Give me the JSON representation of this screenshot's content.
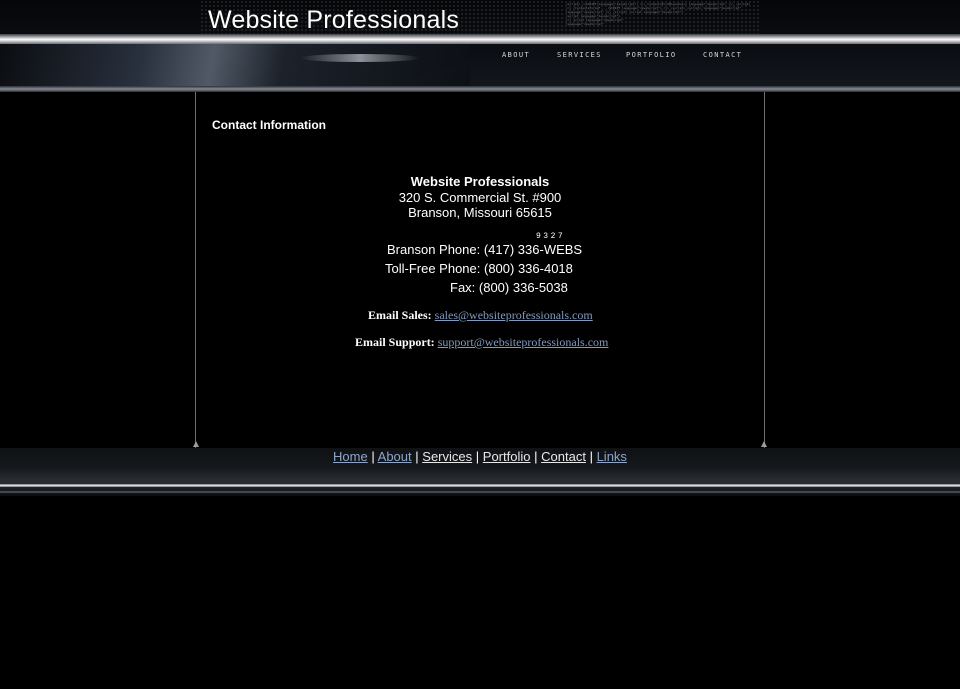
{
  "header": {
    "logo_text": "Website Professionals",
    "nav": [
      "ABOUT",
      "SERVICES",
      "PORTFOLIO",
      "CONTACT"
    ],
    "code_lines": [
      "<script> /<SCRIPT>language=\"JavaScript\"> <\\\\ ContentsFormMouseOver> language=\"JavaScript\" <\\\\ /script> ",
      "<\\\\ /ContentsFormsF... <SCRIPT language=\"JavaScript\"> <\\\\ /script> <script> language=\"JavaScript\"",
      "language=\"JavaScript\" <\\\\ /script> <script language=\"JavaScript\"> ",
      "<script language=\"JavaScript\"> ",
      "<\\\\ script language=\"JavaScript\"",
      "language=\"JavaScript\""
    ]
  },
  "content": {
    "section_title": "Contact Information",
    "company": "Website Professionals",
    "address_line1": "320 S. Commercial St. #900",
    "address_line2": "Branson, Missouri 65615",
    "phone_digits_hint": "9327",
    "branson_phone": "Branson Phone: (417) 336-WEBS",
    "tollfree_phone": "Toll-Free Phone: (800) 336-4018",
    "fax": "Fax: (800) 336-5038",
    "email_sales_label": "Email Sales:",
    "email_sales": "sales@websiteprofessionals.com",
    "email_support_label": "Email Support:",
    "email_support": "support@websiteprofessionals.com"
  },
  "footer": {
    "links": [
      "Home",
      "About",
      "Services",
      "Portfolio",
      "Contact",
      "Links"
    ],
    "separator": "|"
  },
  "colors": {
    "background": "#000000",
    "link_visited": "#8ea5c9",
    "link_normal": "#e8e8e8"
  }
}
